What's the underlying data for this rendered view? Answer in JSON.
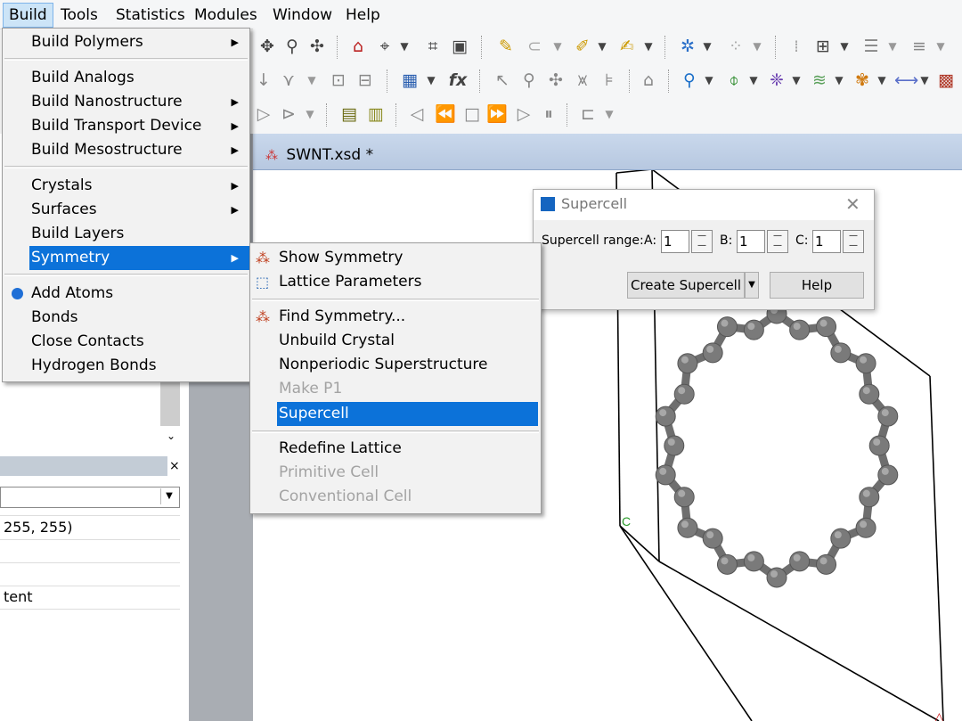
{
  "menubar": {
    "items": [
      "Build",
      "Tools",
      "Statistics",
      "Modules",
      "Window",
      "Help"
    ]
  },
  "build_menu": {
    "items": [
      {
        "label": "Build Polymers",
        "submenu": true
      },
      {
        "label": "Build Analogs",
        "submenu": false
      },
      {
        "label": "Build Nanostructure",
        "submenu": true
      },
      {
        "label": "Build Transport Device",
        "submenu": true
      },
      {
        "label": "Build Mesostructure",
        "submenu": true
      },
      {
        "label": "Crystals",
        "submenu": true
      },
      {
        "label": "Surfaces",
        "submenu": true
      },
      {
        "label": "Build Layers",
        "submenu": false
      },
      {
        "label": "Symmetry",
        "submenu": true
      },
      {
        "label": "Add Atoms",
        "submenu": false
      },
      {
        "label": "Bonds",
        "submenu": false
      },
      {
        "label": "Close Contacts",
        "submenu": false
      },
      {
        "label": "Hydrogen Bonds",
        "submenu": false
      }
    ]
  },
  "symmetry_menu": {
    "items": [
      {
        "label": "Show Symmetry",
        "enabled": true
      },
      {
        "label": "Lattice Parameters",
        "enabled": true
      },
      {
        "label": "Find Symmetry...",
        "enabled": true
      },
      {
        "label": "Unbuild Crystal",
        "enabled": true
      },
      {
        "label": "Nonperiodic Superstructure",
        "enabled": true
      },
      {
        "label": "Make P1",
        "enabled": false
      },
      {
        "label": "Supercell",
        "enabled": true
      },
      {
        "label": "Redefine Lattice",
        "enabled": true
      },
      {
        "label": "Primitive Cell",
        "enabled": false
      },
      {
        "label": "Conventional Cell",
        "enabled": false
      }
    ]
  },
  "document": {
    "tab_title": "SWNT.xsd *"
  },
  "left_panel": {
    "color_text": "255, 255)",
    "row_text": "tent"
  },
  "dialog": {
    "title": "Supercell",
    "range_label": "Supercell range:",
    "a_label": "A:",
    "b_label": "B:",
    "c_label": "C:",
    "a_value": "1",
    "b_value": "1",
    "c_value": "1",
    "create_button": "Create Supercell",
    "help_button": "Help"
  },
  "viewer": {
    "axis_label": "C"
  },
  "colors": {
    "menu_highlight": "#0c72d9",
    "atom_gray": "#7a7a7a",
    "tab_bar": "#c9d8ec"
  }
}
